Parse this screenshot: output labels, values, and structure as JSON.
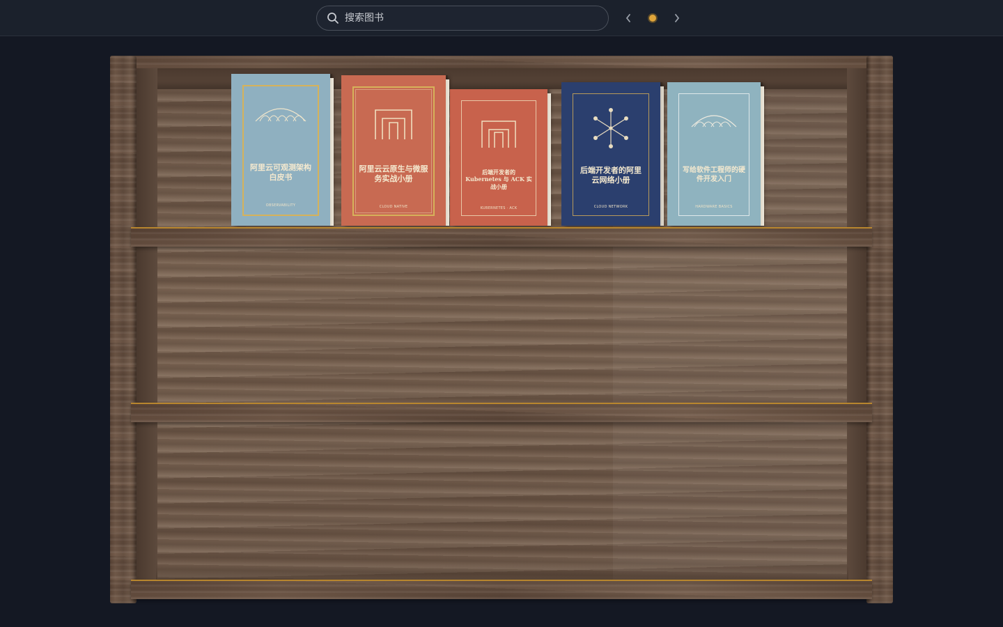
{
  "search": {
    "placeholder": "搜索图书"
  },
  "pagination": {
    "current_page": 1
  },
  "books": [
    {
      "title": "阿里云可观测架构白皮书",
      "subtitle": "OBSERVABILITY",
      "color": "#8fb0c0"
    },
    {
      "title": "阿里云云原生与微服务实战小册",
      "subtitle": "CLOUD NATIVE",
      "color": "#c86a52"
    },
    {
      "title": "后端开发者的 Kubernetes 与 ACK 实战小册",
      "subtitle": "KUBERNETES · ACK",
      "color": "#c8624c"
    },
    {
      "title": "后端开发者的阿里云网络小册",
      "subtitle": "CLOUD NETWORK",
      "color": "#2b3f6e"
    },
    {
      "title": "写给软件工程师的硬件开发入门",
      "subtitle": "HARDWARE BASICS",
      "color": "#8fb3bf"
    }
  ],
  "icons": {
    "search": "search-icon",
    "prev": "chevron-left-icon",
    "next": "chevron-right-icon"
  },
  "colors": {
    "accent": "#e0a53a",
    "background": "#141823",
    "topbar": "#1b212c"
  }
}
